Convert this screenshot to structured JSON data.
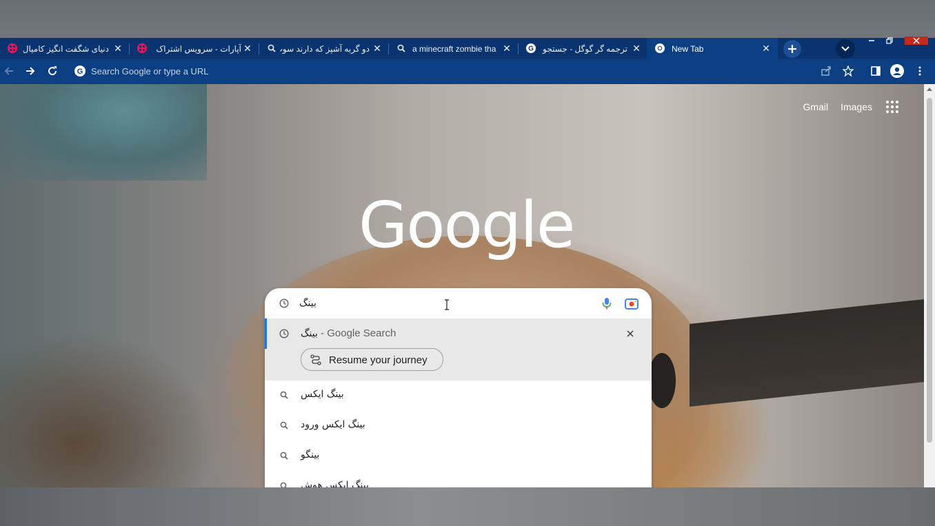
{
  "browser": {
    "tabs": [
      {
        "title": "دنیای شگفت انگیز کامیال فصل",
        "favicon": "aparat-icon",
        "rtl": true,
        "active": false
      },
      {
        "title": "آپارات - سرویس اشتراک ویدیو",
        "favicon": "aparat-icon",
        "rtl": true,
        "active": false
      },
      {
        "title": "دو گربه آشپز که دارند سوپ جو",
        "favicon": "search-icon",
        "rtl": true,
        "active": false
      },
      {
        "title": "a minecraft zombie tha",
        "favicon": "search-icon",
        "rtl": false,
        "active": false
      },
      {
        "title": "ترجمه گر گوگل - جستجوی Ie",
        "favicon": "google-icon",
        "rtl": true,
        "active": false
      },
      {
        "title": "New Tab",
        "favicon": "chrome-icon",
        "rtl": false,
        "active": true
      }
    ],
    "omnibox_placeholder": "Search Google or type a URL",
    "colors": {
      "frame": "#0c3e82",
      "tabstrip": "#0a3470",
      "accent": "#1a73e8"
    }
  },
  "ntp": {
    "links": {
      "gmail": "Gmail",
      "images": "Images"
    },
    "logo": "Google"
  },
  "search": {
    "query": "بینگ",
    "history_suggestion": {
      "text": "بینگ",
      "suffix": " - Google Search"
    },
    "journey_chip": "Resume your journey",
    "suggestions": [
      "بینگ ایکس",
      "بینگ ایکس ورود",
      "بینگو",
      "بینگ ایکس هوش"
    ]
  }
}
